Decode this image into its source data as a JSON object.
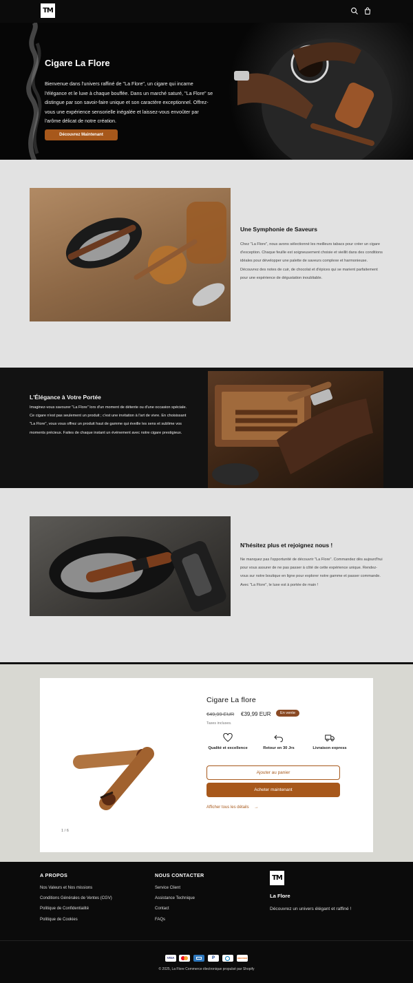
{
  "header": {
    "logo_text": "TM",
    "icons": [
      "search-icon",
      "cart-icon"
    ]
  },
  "hero": {
    "title": "Cigare La Flore",
    "text": "Bienvenue dans l'univers raffiné de \"La Flore\", un cigare qui incarne l'élégance et le luxe à chaque bouffée. Dans un marché saturé, \"La Flore\" se distingue par son savoir-faire unique et son caractère exceptionnel. Offrez-vous une expérience sensorielle inégalée et laissez-vous envoûter par l'arôme délicat de notre création.",
    "button_label": "Découvrez Maintenant"
  },
  "sections": [
    {
      "title": "Une Symphonie de Saveurs",
      "text": "Chez \"La Flore\", nous avons sélectionné les meilleurs tabacs pour créer un cigare d'exception. Chaque feuille est soigneusement choisie et vieillit dans des conditions idéales pour développer une palette de saveurs complexe et harmonieuse. Découvrez des notes de cuir, de chocolat et d'épices qui se marient parfaitement pour une expérience de dégustation inoubliable."
    },
    {
      "title": "L'Élégance à Votre Portée",
      "text": "Imaginez-vous savourer \"La Flore\" lors d'un moment de détente ou d'une occasion spéciale. Ce cigare n'est pas seulement un produit ; c'est une invitation à l'art de vivre. En choisissant \"La Flore\", vous vous offrez un produit haut de gamme qui éveille les sens et sublime vos moments précieux. Faites de chaque instant un événement avec notre cigare prestigieux."
    },
    {
      "title": "N'hésitez plus et rejoignez nous !",
      "text": "Ne manquez pas l'opportunité de découvrir \"La Flore\". Commandez dès aujourd'hui pour vous assurer de ne pas passer à côté de cette expérience unique. Rendez-vous sur notre boutique en ligne pour explorer notre gamme et passer commande. Avec \"La Flore\", le luxe est à portée de main !"
    }
  ],
  "product": {
    "title": "Cigare La flore",
    "old_price": "€49,99 EUR",
    "price": "€39,99 EUR",
    "badge": "En vente",
    "tax_note": "Taxes incluses.",
    "features": [
      {
        "icon": "heart-icon",
        "label": "Qualité et excellence"
      },
      {
        "icon": "return-arrow-icon",
        "label": "Retour en 30 Jrs"
      },
      {
        "icon": "truck-icon",
        "label": "Livraison express"
      }
    ],
    "add_to_cart": "Ajouter au panier",
    "buy_now": "Acheter maintenant",
    "details_link": "Afficher tous les détails",
    "pager": "1 / 6"
  },
  "footer": {
    "about_title": "A PROPOS",
    "about_links": [
      "Nos Valeurs et Nos missions",
      "Conditions Générales de Ventes (CGV)",
      "Politique de Confidentialité",
      "Politique de Cookies"
    ],
    "contact_title": "NOUS CONTACTER",
    "contact_links": [
      "Service Client",
      "Assistance Technique",
      "Contact",
      "FAQs"
    ],
    "logo_text": "TM",
    "brand": "La Flore",
    "tagline": "Découvrez un univers élégant et raffiné !",
    "payment_icons": [
      "visa-icon",
      "mastercard-icon",
      "amex-icon",
      "paypal-icon",
      "diners-icon",
      "discover-icon"
    ],
    "payment_labels": [
      "VISA",
      "",
      "",
      "P",
      "",
      "DISCOVER"
    ],
    "copyright": "© 2025, La Flore Commerce électronique propulsé par Shopify"
  },
  "colors": {
    "accent": "#a7581b",
    "badge": "#8a4a24",
    "dark": "#121212",
    "light": "#e2e2e2"
  }
}
